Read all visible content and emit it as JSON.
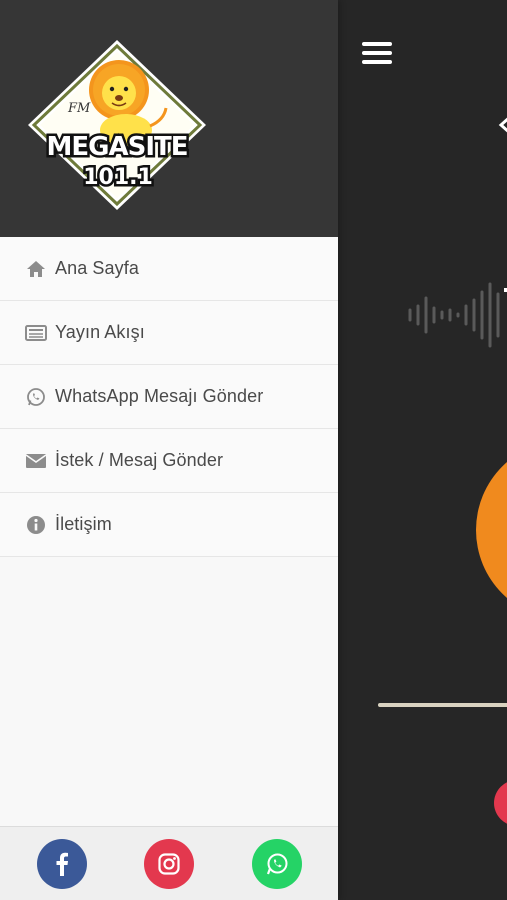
{
  "menu": {
    "items": [
      {
        "label": "Ana Sayfa",
        "icon": "home-icon"
      },
      {
        "label": "Yayın Akışı",
        "icon": "schedule-list-icon"
      },
      {
        "label": "WhatsApp Mesajı Gönder",
        "icon": "whatsapp-icon"
      },
      {
        "label": "İstek / Mesaj Gönder",
        "icon": "envelope-icon"
      },
      {
        "label": "İletişim",
        "icon": "info-icon"
      }
    ]
  },
  "logo": {
    "brand": "MEGASITE",
    "frequency": "101.1",
    "tag": "FM"
  },
  "social": [
    "facebook-icon",
    "instagram-icon",
    "whatsapp-icon"
  ],
  "colors": {
    "drawer_header": "#363636",
    "player_bg": "#262626",
    "accent_orange": "#f08a1e",
    "facebook": "#3b5998",
    "instagram": "#e3384e",
    "whatsapp": "#25d366"
  }
}
